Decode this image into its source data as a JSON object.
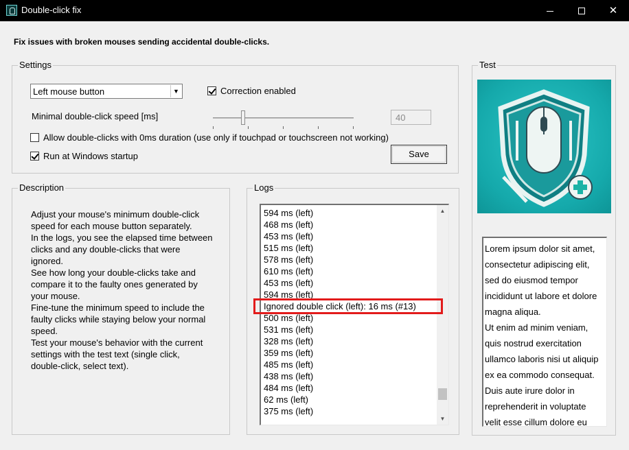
{
  "window": {
    "title": "Double-click fix",
    "minimize_label": "Minimize",
    "maximize_label": "Maximize",
    "close_label": "Close",
    "close_glyph": "✕"
  },
  "headline": "Fix issues with broken mouses sending accidental double-clicks.",
  "settings": {
    "group_label": "Settings",
    "mouse_button_selected": "Left mouse button",
    "correction_label": "Correction enabled",
    "correction_checked": true,
    "speed_label": "Minimal double-click speed [ms]",
    "speed_value": "40",
    "speed_slider_fraction": 0.2,
    "allow_zero_label": "Allow double-clicks with 0ms duration (use only if touchpad or touchscreen not working)",
    "allow_zero_checked": false,
    "startup_label": "Run at Windows startup",
    "startup_checked": true,
    "save_label": "Save"
  },
  "description": {
    "group_label": "Description",
    "lines": [
      "Adjust your mouse's minimum double-click",
      "speed for each mouse button separately.",
      "In the logs, you see the elapsed time between",
      "clicks and any double-clicks that were",
      "ignored.",
      "See how long your double-clicks take and",
      "compare it to the faulty ones generated by",
      "your mouse.",
      "Fine-tune the minimum speed to include the",
      "faulty clicks while staying below your normal",
      "speed.",
      "Test your mouse's behavior with the current",
      "settings with the test text (single click,",
      "double-click, select text)."
    ]
  },
  "logs": {
    "group_label": "Logs",
    "entries": [
      "594 ms (left)",
      "468 ms (left)",
      "453 ms (left)",
      "515 ms (left)",
      "578 ms (left)",
      "610 ms (left)",
      "453 ms (left)",
      "594 ms (left)",
      "Ignored double click (left): 16 ms (#13)",
      "500 ms (left)",
      "531 ms (left)",
      "328 ms (left)",
      "359 ms (left)",
      "485 ms (left)",
      "438 ms (left)",
      "484 ms (left)",
      "62 ms (left)",
      "375 ms (left)"
    ],
    "highlighted_index": 8
  },
  "test": {
    "group_label": "Test",
    "image_icon": "shield-mouse-medical-icon",
    "text_lines": [
      "Lorem ipsum dolor sit amet,",
      "consectetur adipiscing elit,",
      "sed do eiusmod tempor",
      "incididunt ut labore et dolore",
      "magna aliqua.",
      "Ut enim ad minim veniam,",
      "quis nostrud exercitation",
      "ullamco laboris nisi ut aliquip",
      "ex ea commodo consequat.",
      "Duis aute irure dolor in",
      "reprehenderit in voluptate",
      "velit esse cillum dolore eu"
    ]
  },
  "colors": {
    "titlebar": "#000000",
    "window_bg": "#f0f0f0",
    "highlight_border": "#e21b1b",
    "image_teal": "#17a9ab"
  }
}
